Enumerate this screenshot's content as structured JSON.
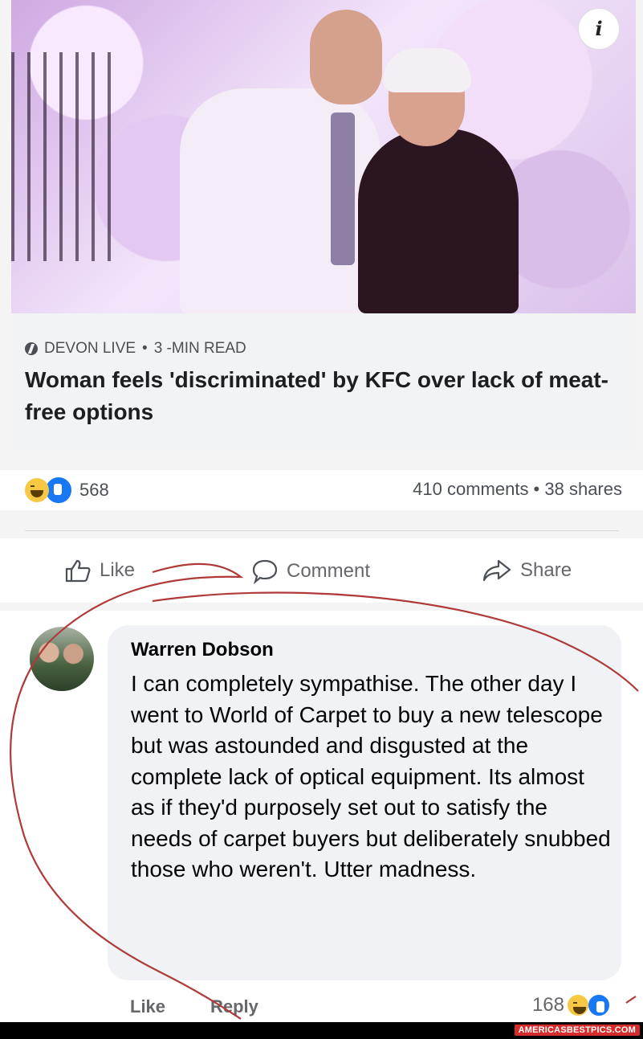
{
  "post": {
    "source": "DEVON LIVE",
    "read_time": "3 -MIN READ",
    "headline": "Woman feels 'discriminated' by KFC over lack of meat-free options",
    "info_glyph": "i"
  },
  "stats": {
    "reaction_count": "568",
    "comments_shares": "410 comments • 38 shares",
    "reaction_icons": [
      "haha-icon",
      "like-icon"
    ]
  },
  "actions": {
    "like": "Like",
    "comment": "Comment",
    "share": "Share"
  },
  "comment": {
    "author": "Warren Dobson",
    "text": "I can completely sympathise. The other day I went to World of Carpet to buy a new telescope but was astounded and disgusted at the complete lack of optical equipment. Its almost as if they'd purposely set out to satisfy the needs of carpet buyers but deliberately snubbed those who weren't. Utter madness.",
    "like_label": "Like",
    "reply_label": "Reply",
    "reaction_count": "168"
  },
  "watermark": "AMERICASBESTPICS.COM",
  "colors": {
    "reaction_blue": "#1877f2",
    "haha_yellow": "#f7c844",
    "annotation_red": "#b03a3a",
    "watermark_red": "#d42b2b"
  }
}
